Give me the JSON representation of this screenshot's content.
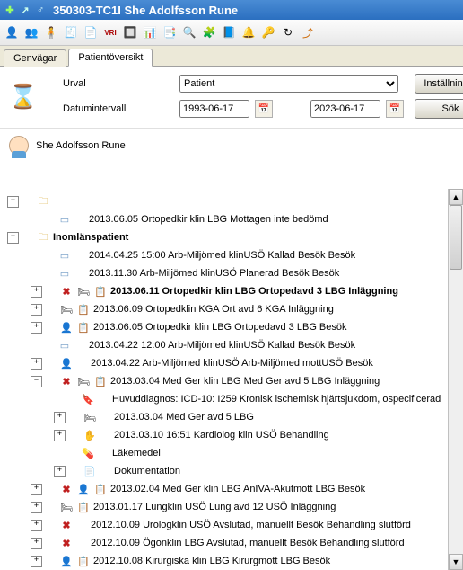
{
  "title": "350303-TC1I  She Adolfsson Rune",
  "tabs": {
    "shortcuts": "Genvägar",
    "overview": "Patientöversikt"
  },
  "search": {
    "urval_label": "Urval",
    "urval_value": "Patient",
    "date_label": "Datumintervall",
    "date_from": "1993-06-17",
    "date_to": "2023-06-17",
    "settings_btn": "Inställningar",
    "search_btn": "Sök"
  },
  "patient_name": "She Adolfsson Rune",
  "tree": {
    "n1": "2013.06.05 Ortopedkir klin LBG Mottagen inte bedömd",
    "grp": "Inomlänspatient",
    "n2": "2014.04.25 15:00 Arb-Miljömed klinUSÖ Kallad Besök Besök",
    "n3": "2013.11.30 Arb-Miljömed klinUSÖ Planerad Besök Besök",
    "n4": "2013.06.11 Ortopedkir klin LBG Ortopedavd 3 LBG Inläggning",
    "n5": "2013.06.09 Ortopedklin KGA Ort avd 6 KGA Inläggning",
    "n6": "2013.06.05 Ortopedkir klin LBG Ortopedavd 3 LBG Besök",
    "n7": "2013.04.22 12:00 Arb-Miljömed klinUSÖ Kallad Besök Besök",
    "n8": "2013.04.22 Arb-Miljömed klinUSÖ Arb-Miljömed mottUSÖ Besök",
    "n9": "2013.03.04 Med Ger klin LBG Med Ger avd 5 LBG Inläggning",
    "n9a": "Huvuddiagnos: ICD-10: I259 Kronisk ischemisk hjärtsjukdom, ospecificerad",
    "n9b": "2013.03.04 Med Ger avd 5 LBG",
    "n9c": "2013.03.10 16:51 Kardiolog klin USÖ Behandling",
    "n9d": "Läkemedel",
    "n9e": "Dokumentation",
    "n10": "2013.02.04 Med Ger klin LBG AnIVA-Akutmott LBG Besök",
    "n11": "2013.01.17 Lungklin USÖ Lung avd 12 USÖ Inläggning",
    "n12": "2012.10.09 Urologklin USÖ Avslutad, manuellt Besök Behandling slutförd",
    "n13": "2012.10.09 Ögonklin LBG Avslutad, manuellt Besök Behandling slutförd",
    "n14": "2012.10.08 Kirurgiska klin LBG Kirurgmott LBG Besök"
  }
}
